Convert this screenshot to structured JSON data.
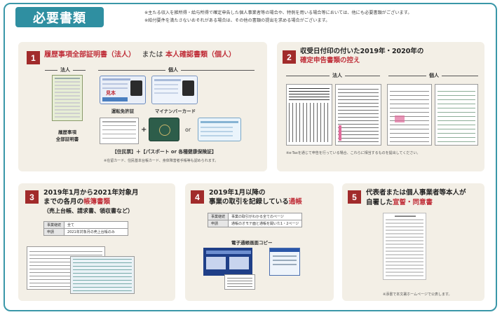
{
  "header": {
    "title": "必要書類",
    "note1": "※主たる収入を雑所得・給与所得で確定申告した個人事業者等の場合や、特例を用いる場合等においては、他にも必要書類がございます。",
    "note2": "※給付要件を満たさないおそれがある場合は、その他の書類の提出を求める場合がございます。"
  },
  "section1": {
    "number": "1",
    "title_a": "履歴事項全部証明書（法人）",
    "title_mid": "または",
    "title_b": "本人確認書類（個人）",
    "corp_label": "法人",
    "indiv_label": "個人",
    "corp_doc_caption_1": "履歴事項",
    "corp_doc_caption_2": "全部証明書",
    "license_caption": "運転免許証",
    "license_text": "見本",
    "mynumber_caption": "マイナンバーカード",
    "plus": "+",
    "or": "or",
    "bottom_caption": "【住民票】＋【パスポート or 各種健康保険証】",
    "footnote": "※在留カード、住民基本台帳カード、身体障害者手帳等も認められます。"
  },
  "section2": {
    "number": "2",
    "title_1": "収受日付印の付いた2019年・2020年の",
    "title_2": "確定申告書類の控え",
    "corp_label": "法人",
    "indiv_label": "個人",
    "footnote": "※e-Taxを通じて申告を行っている場合、これらに相当するものを提出してください。"
  },
  "section3": {
    "number": "3",
    "title_1": "2019年1月から2021年対象月",
    "title_2a": "までの各月の",
    "title_2b": "帳簿書類",
    "title_3": "（売上台帳、請求書、領収書など）",
    "table": [
      [
        "事業継続",
        "全て"
      ],
      [
        "申請",
        "2021年対象月の売上台帳のみ"
      ]
    ]
  },
  "section4": {
    "number": "4",
    "title_1": "2019年1月以降の",
    "title_2a": "事業の取引を記録している",
    "title_2b": "通帳",
    "table": [
      [
        "事業継続",
        "事業の取引がわかる全てのページ"
      ],
      [
        "申請",
        "通帳のオモテ面と通帳を開いた1・2ページ"
      ]
    ],
    "copy_caption": "電子通帳画面コピー"
  },
  "section5": {
    "number": "5",
    "title_1": "代表者または個人事業者等本人が",
    "title_2a": "自署した",
    "title_2b": "宣誓・同意書",
    "footnote": "※添書で本文署ホームページで公表します。"
  },
  "colors": {
    "frame": "#3a97a8",
    "accent_red": "#c0303a",
    "number_badge": "#a12b2b",
    "panel_bg": "#f3efe6"
  }
}
